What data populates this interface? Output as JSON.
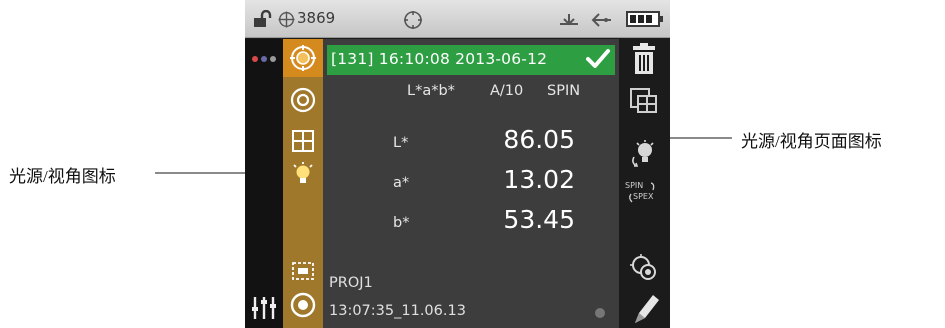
{
  "annotations": {
    "left_label": "光源/视角图标",
    "right_label": "光源/视角页面图标"
  },
  "status_bar": {
    "counter": "3869",
    "icons": [
      "unlock-icon",
      "crosshair-icon",
      "target-icon",
      "usb-icon",
      "connection-icon",
      "battery-icon"
    ]
  },
  "measurement": {
    "header": "[131] 16:10:08 2013-06-12",
    "status": "ok",
    "color_space": "L*a*b*",
    "illuminant_observer": "A/10",
    "spin_mode": "SPIN",
    "rows": [
      {
        "label": "L*",
        "value": "86.05"
      },
      {
        "label": "a*",
        "value": "13.02"
      },
      {
        "label": "b*",
        "value": "53.45"
      }
    ]
  },
  "footer": {
    "project": "PROJ1",
    "timestamp": "13:07:35_11.06.13"
  },
  "side_buttons": {
    "spin_label": "SPIN",
    "spex_label": "SPEX"
  },
  "colors": {
    "accent_orange": "#d58a1e",
    "strip_brown": "#a0782c",
    "header_green": "#2e9e43",
    "screen_bg": "#3d3d3d"
  }
}
